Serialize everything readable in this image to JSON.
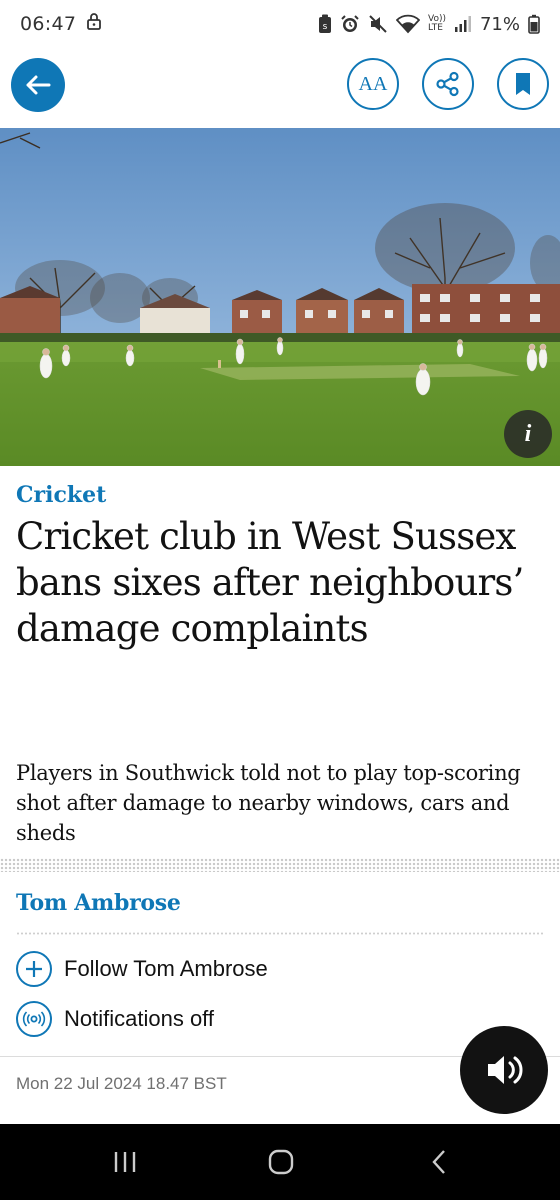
{
  "status_bar": {
    "time": "06:47",
    "battery": "71%",
    "network_label_top": "Vo))",
    "network_label_bottom": "LTE"
  },
  "toolbar": {
    "back_icon": "arrow-left-icon",
    "text_size_label": "AA",
    "share_icon": "share-icon",
    "bookmark_icon": "bookmark-icon"
  },
  "hero": {
    "info_label": "i"
  },
  "article": {
    "kicker": "Cricket",
    "headline": "Cricket club in West Sussex bans sixes after neighbours’ damage complaints",
    "standfirst": "Players in Southwick told not to play top-scoring shot after damage to nearby windows, cars and sheds",
    "byline": "Tom Ambrose",
    "follow_label": "Follow Tom Ambrose",
    "notifications_label": "Notifications off",
    "dateline": "Mon 22 Jul 2024 18.47 BST"
  },
  "colors": {
    "accent": "#0f77b6",
    "text": "#121212",
    "meta": "#707070"
  }
}
